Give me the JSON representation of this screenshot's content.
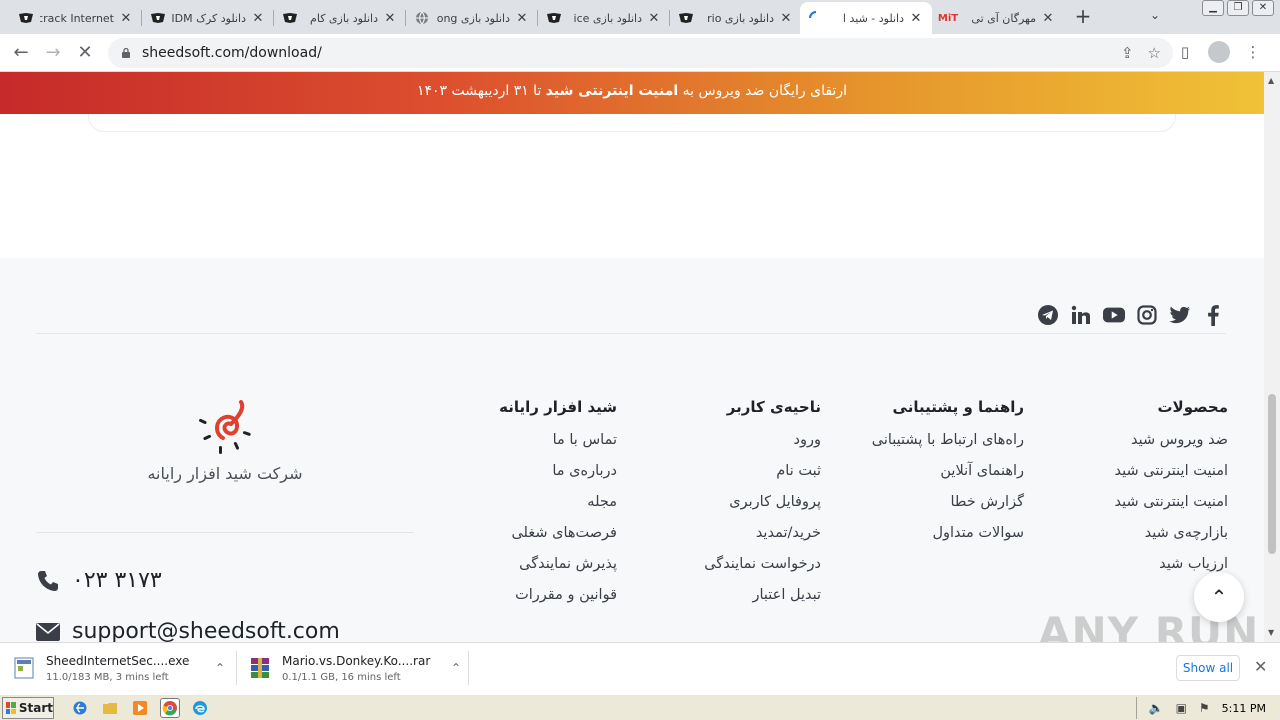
{
  "browser": {
    "tabs": [
      {
        "title": "crack Internet",
        "favicon": "shield-logo-icon",
        "active": false
      },
      {
        "title": "دانلود کرک IDM",
        "favicon": "shield-logo-icon",
        "active": false
      },
      {
        "title": "دانلود بازی کام",
        "favicon": "shield-logo-icon",
        "active": false
      },
      {
        "title": "دانلود بازی long",
        "favicon": "globe-icon",
        "active": false
      },
      {
        "title": "دانلود بازی ice",
        "favicon": "shield-logo-icon",
        "active": false
      },
      {
        "title": "دانلود بازی rio",
        "favicon": "shield-logo-icon",
        "active": false
      },
      {
        "title": "دانلود - شید ا",
        "favicon": "loading-spinner-icon",
        "active": true
      },
      {
        "title": "مهرگان آی تی",
        "favicon": "mit-logo-icon",
        "active": false
      }
    ],
    "url": "sheedsoft.com/download/"
  },
  "page": {
    "banner": {
      "part1": "ارتقای رایگان ضد ویروس به ",
      "bold1": "امنیت اینترنتی شید",
      "part2": " تا ۳۱ اردیبهشت ۱۴۰۳"
    },
    "footer": {
      "columns": [
        {
          "heading": "محصولات",
          "links": [
            "ضد ویروس شید",
            "امنیت اینترنتی شید",
            "امنیت اینترنتی شید",
            "بازارچه‌ی شید",
            "ارزیاب شید"
          ]
        },
        {
          "heading": "راهنما و پشتیبانی",
          "links": [
            "راه‌های ارتباط با پشتیبانی",
            "راهنمای آنلاین",
            "گزارش خطا",
            "سوالات متداول"
          ]
        },
        {
          "heading": "ناحیه‌ی کاربر",
          "links": [
            "ورود",
            "ثبت نام",
            "پروفایل کاربری",
            "خرید/تمدید",
            "درخواست نمایندگی",
            "تبدیل اعتبار"
          ]
        },
        {
          "heading": "شید افزار رایانه",
          "links": [
            "تماس با ما",
            "درباره‌ی ما",
            "مجله",
            "فرصت‌های شغلی",
            "پذیرش نمایندگی",
            "قوانین و مقررات"
          ]
        }
      ],
      "company_name": "شرکت شید افزار رایانه",
      "phone": "۰۲۳ ۳۱۷۳",
      "email": "support@sheedsoft.com",
      "social_icons": [
        "telegram-icon",
        "linkedin-icon",
        "youtube-icon",
        "instagram-icon",
        "twitter-icon",
        "facebook-icon"
      ]
    }
  },
  "downloads": [
    {
      "name": "SheedInternetSec....exe",
      "status": "11.0/183 MB, 3 mins left"
    },
    {
      "name": "Mario.vs.Donkey.Ko....rar",
      "status": "0.1/1.1 GB, 16 mins left"
    }
  ],
  "show_all": "Show all",
  "watermark": "ANY RUN",
  "taskbar": {
    "start": "Start",
    "clock": "5:11 PM"
  },
  "colors": {
    "banner_start": "#c62a2a",
    "banner_end": "#f0c237",
    "logo_red": "#e0412f",
    "link_blue": "#1a73e8"
  }
}
